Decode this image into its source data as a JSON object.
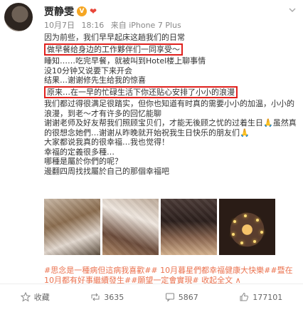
{
  "user": {
    "name": "贾静雯",
    "verified_badge": "V",
    "heart": "❤"
  },
  "meta": {
    "date": "10月7日",
    "time": "18:16",
    "source": "来自 iPhone 7 Plus"
  },
  "post": {
    "lines": [
      "因为前些，我们早早起床这趟我们的日常",
      "做早餐给身边的工作夥伴们一同享受～",
      "睡知……吃完早餐，就被叫到Hotel楼上聊事情",
      "没10分钟又说要下来开会",
      "结果…谢谢修先生给我的惊喜",
      "原来…在一早的忙碌生活下你还贴心安排了小小的浪漫",
      "我们都过得很满足很踏实，但你也知道有时真的需要小小的加温，小小的浪漫，到老～才有许多的回忆能聊",
      "谢谢老师及好友帮我们照顾宝贝们，才能无後顾之忧的过着生日🙏虽然真的很想念她們…谢谢从昨晚就开始祝我生日快乐的朋友们🙏",
      "大家都说我真的很幸福…我也觉得！",
      "幸福的定義很多種…",
      "哪種是屬於你們的呢？",
      "邊翻四周找找屬於自己的那個幸福吧",
      "#思念是一種病但這病我喜歡## 10月暮星們都幸福健康大快樂##暨在10月都有好事繼續發生##願望一定會實現#"
    ],
    "boxed_line_1": "做早餐给身边的工作夥伴们一同享受～",
    "boxed_line_2": "原来…在一早的忙碌生活下你还贴心安排了小小的浪漫",
    "hashtags": "#思念是一種病但這病我喜歡## 10月暮星們都幸福健康大快樂##暨在10月都有好事繼續發生##願望一定會實現#",
    "location": "收起全文",
    "collapse": "∧"
  },
  "actions": {
    "collect": "收藏",
    "repost": "3635",
    "comment": "5867",
    "like": "177101"
  },
  "colors": {
    "accent": "#eb7350",
    "box": "#e0201c"
  }
}
